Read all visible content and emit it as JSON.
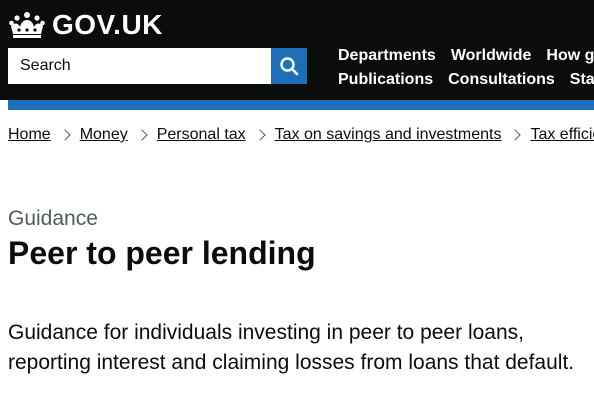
{
  "header": {
    "logo_text": "GOV.UK",
    "search": {
      "placeholder": "Search",
      "value": ""
    },
    "nav": {
      "row1": [
        "Departments",
        "Worldwide",
        "How government works"
      ],
      "row2": [
        "Publications",
        "Consultations",
        "Statistics"
      ]
    }
  },
  "breadcrumbs": [
    "Home",
    "Money",
    "Personal tax",
    "Tax on savings and investments",
    "Tax efficient savings and investments"
  ],
  "page": {
    "caption": "Guidance",
    "title": "Peer to peer lending",
    "lead": "Guidance for individuals investing in peer to peer loans, reporting interest and claiming losses from loans that default."
  },
  "icons": {
    "logo": "crown-icon",
    "search_button": "search-icon",
    "breadcrumb_separator": "chevron-right-icon"
  },
  "colors": {
    "header_bg": "#0b0c0c",
    "brand_blue": "#1d70b8",
    "caption_grey": "#505a5f",
    "text": "#0b0c0c"
  }
}
